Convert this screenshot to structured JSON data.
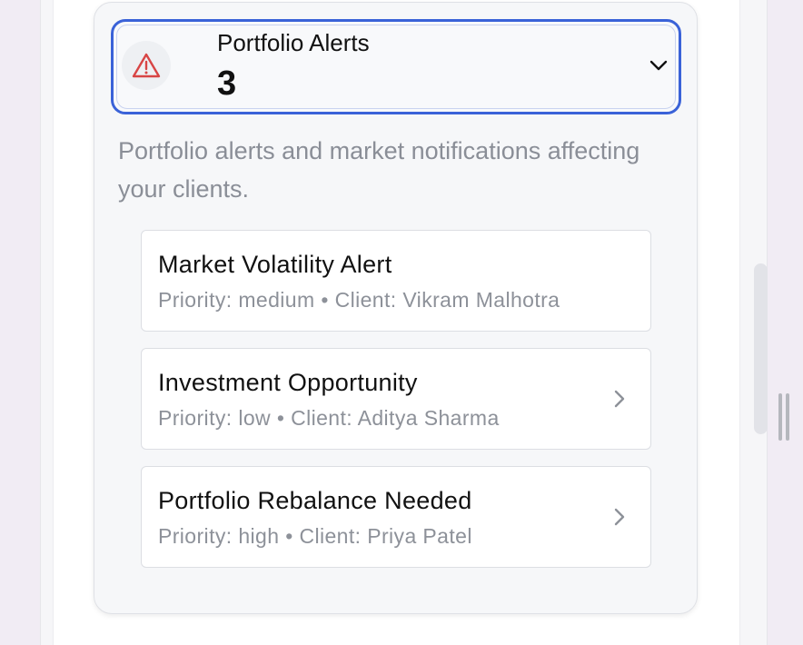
{
  "panel": {
    "title": "Portfolio Alerts",
    "count": "3",
    "description": "Portfolio alerts and market notifications affecting your clients.",
    "icon": "warning-triangle-icon",
    "accent_color": "#3a62d8",
    "warning_color": "#d84545"
  },
  "alerts": [
    {
      "title": "Market Volatility Alert",
      "meta": "Priority: medium • Client: Vikram Malhotra"
    },
    {
      "title": "Investment Opportunity",
      "meta": "Priority: low • Client: Aditya Sharma"
    },
    {
      "title": "Portfolio Rebalance Needed",
      "meta": "Priority: high • Client: Priya Patel"
    }
  ]
}
